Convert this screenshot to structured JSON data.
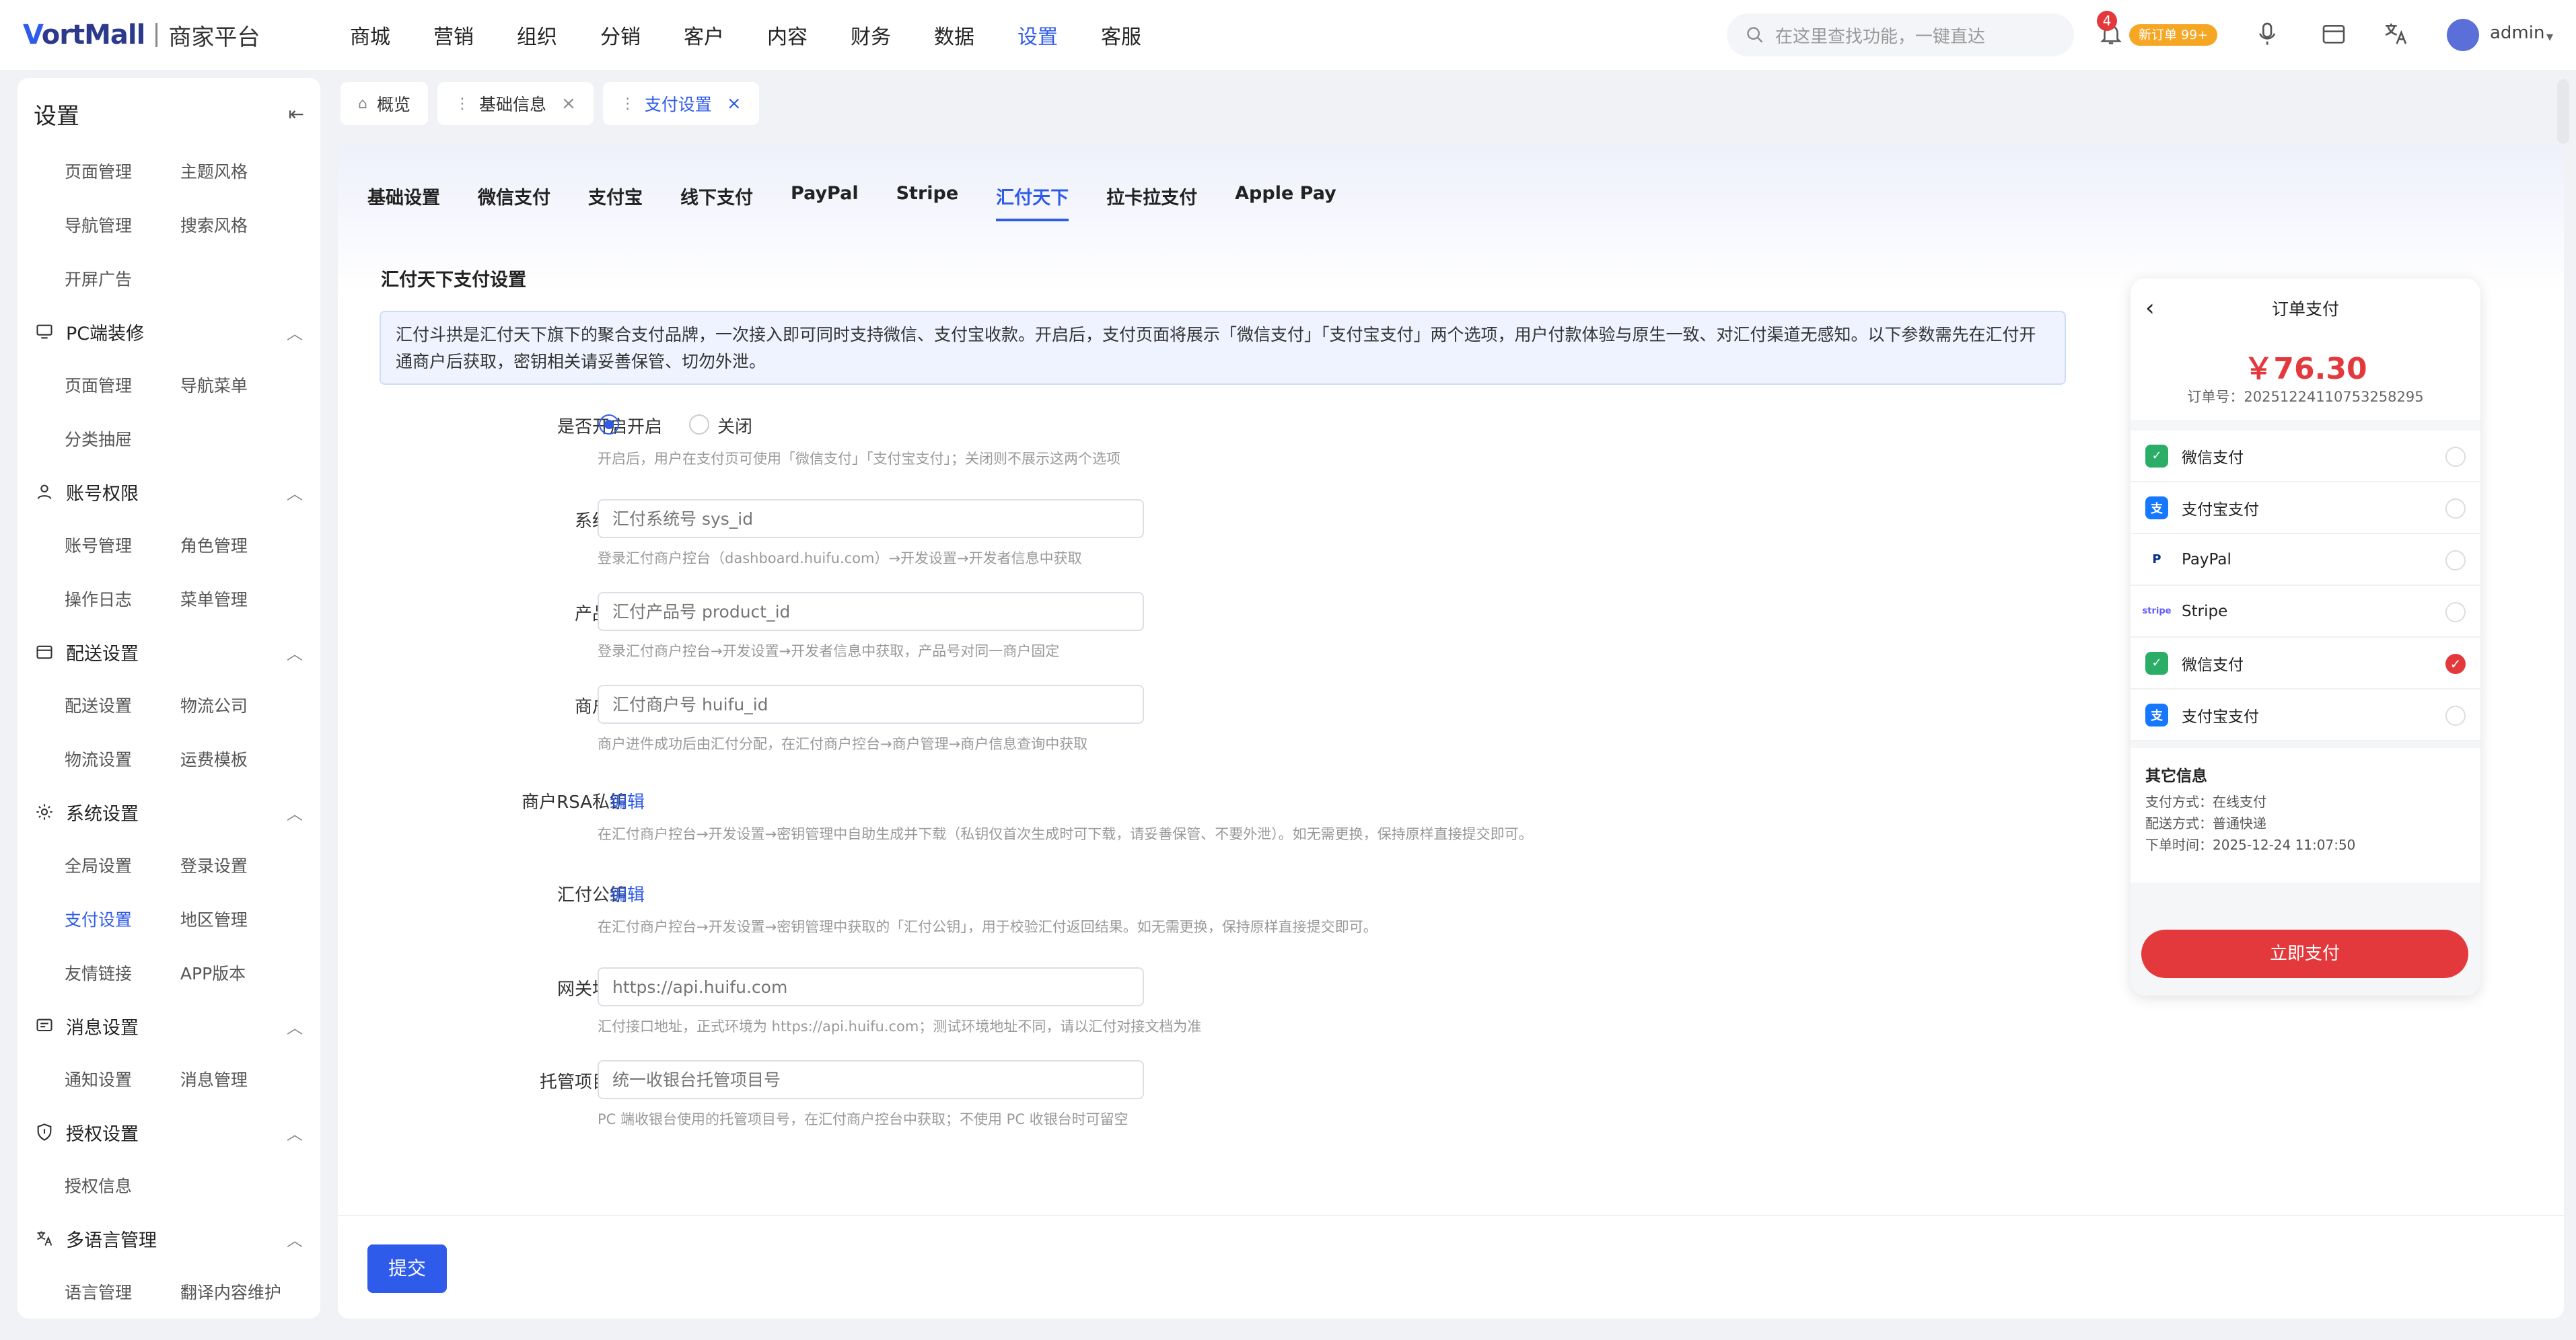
{
  "app": {
    "logo_text": "ortMall",
    "logo_v": "V",
    "subtitle": "商家平台"
  },
  "nav": [
    "商城",
    "营销",
    "组织",
    "分销",
    "客户",
    "内容",
    "财务",
    "数据",
    "设置",
    "客服"
  ],
  "nav_active": "设置",
  "search": {
    "placeholder": "在这里查找功能，一键直达"
  },
  "notifications": {
    "count": "4",
    "order_badge": "新订单 99+"
  },
  "user": {
    "name": "admin"
  },
  "sidebar": {
    "title": "设置",
    "groups": [
      {
        "label": "",
        "items": [
          "页面管理",
          "主题风格",
          "导航管理",
          "搜索风格",
          "开屏广告"
        ]
      },
      {
        "label": "PC端装修",
        "items": [
          "页面管理",
          "导航菜单",
          "分类抽屉"
        ]
      },
      {
        "label": "账号权限",
        "items": [
          "账号管理",
          "角色管理",
          "操作日志",
          "菜单管理"
        ]
      },
      {
        "label": "配送设置",
        "items": [
          "配送设置",
          "物流公司",
          "物流设置",
          "运费模板"
        ]
      },
      {
        "label": "系统设置",
        "items": [
          "全局设置",
          "登录设置",
          "支付设置",
          "地区管理",
          "友情链接",
          "APP版本"
        ]
      },
      {
        "label": "消息设置",
        "items": [
          "通知设置",
          "消息管理"
        ]
      },
      {
        "label": "授权设置",
        "items": [
          "授权信息"
        ]
      },
      {
        "label": "多语言管理",
        "items": [
          "语言管理",
          "翻译内容维护"
        ]
      }
    ],
    "active_item": "支付设置"
  },
  "tabs": [
    {
      "label": "概览"
    },
    {
      "label": "基础信息"
    },
    {
      "label": "支付设置"
    }
  ],
  "sub_tabs": [
    "基础设置",
    "微信支付",
    "支付宝",
    "线下支付",
    "PayPal",
    "Stripe",
    "汇付天下",
    "拉卡拉支付",
    "Apple Pay"
  ],
  "sub_tab_active": "汇付天下",
  "section_title": "汇付天下支付设置",
  "notice": "汇付斗拱是汇付天下旗下的聚合支付品牌，一次接入即可同时支持微信、支付宝收款。开启后，支付页面将展示「微信支付」「支付宝支付」两个选项，用户付款体验与原生一致、对汇付渠道无感知。以下参数需先在汇付开通商户后获取，密钥相关请妥善保管、切勿外泄。",
  "form": {
    "enable": {
      "label": "是否开启",
      "on": "开启",
      "off": "关闭",
      "hint": "开启后，用户在支付页可使用「微信支付」「支付宝支付」；关闭则不展示这两个选项"
    },
    "sys_id": {
      "label": "系统号",
      "placeholder": "汇付系统号 sys_id",
      "hint": "登录汇付商户控台（dashboard.huifu.com）→开发设置→开发者信息中获取"
    },
    "product_id": {
      "label": "产品号",
      "placeholder": "汇付产品号 product_id",
      "hint": "登录汇付商户控台→开发设置→开发者信息中获取，产品号对同一商户固定"
    },
    "huifu_id": {
      "label": "商户号",
      "placeholder": "汇付商户号 huifu_id",
      "hint": "商户进件成功后由汇付分配，在汇付商户控台→商户管理→商户信息查询中获取"
    },
    "rsa_private": {
      "label": "商户RSA私钥",
      "edit": "编辑",
      "hint": "在汇付商户控台→开发设置→密钥管理中自助生成并下载（私钥仅首次生成时可下载，请妥善保管、不要外泄）。如无需更换，保持原样直接提交即可。"
    },
    "public_key": {
      "label": "汇付公钥",
      "edit": "编辑",
      "hint": "在汇付商户控台→开发设置→密钥管理中获取的「汇付公钥」，用于校验汇付返回结果。如无需更换，保持原样直接提交即可。"
    },
    "gateway": {
      "label": "网关地址",
      "placeholder": "https://api.huifu.com",
      "hint": "汇付接口地址，正式环境为 https://api.huifu.com；测试环境地址不同，请以汇付对接文档为准"
    },
    "project_id": {
      "label": "托管项目号",
      "placeholder": "统一收银台托管项目号",
      "hint": "PC 端收银台使用的托管项目号，在汇付商户控台中获取；不使用 PC 收银台时可留空"
    }
  },
  "submit_label": "提交",
  "preview": {
    "title": "订单支付",
    "back": "‹",
    "amount": "￥76.30",
    "order_no": "订单号：20251224110753258295",
    "methods": [
      {
        "label": "微信支付",
        "icon": "wechat-icon",
        "color": "#2aae67",
        "checked": false
      },
      {
        "label": "支付宝支付",
        "icon": "alipay-icon",
        "color": "#1677ff",
        "checked": false
      },
      {
        "label": "PayPal",
        "icon": "paypal-icon",
        "color": "#003087",
        "checked": false
      },
      {
        "label": "Stripe",
        "icon": "stripe-icon",
        "color": "#635bff",
        "checked": false
      },
      {
        "label": "微信支付",
        "icon": "wechat-icon",
        "color": "#2aae67",
        "checked": true
      },
      {
        "label": "支付宝支付",
        "icon": "alipay-icon",
        "color": "#1677ff",
        "checked": false
      }
    ],
    "other_title": "其它信息",
    "other_lines": [
      "支付方式：在线支付",
      "配送方式：普通快递",
      "下单时间：2025-12-24 11:07:50"
    ],
    "pay_button": "立即支付"
  },
  "colors": {
    "accent": "#2f5bea",
    "danger": "#e4393c",
    "order_badge": "#f5a623"
  }
}
